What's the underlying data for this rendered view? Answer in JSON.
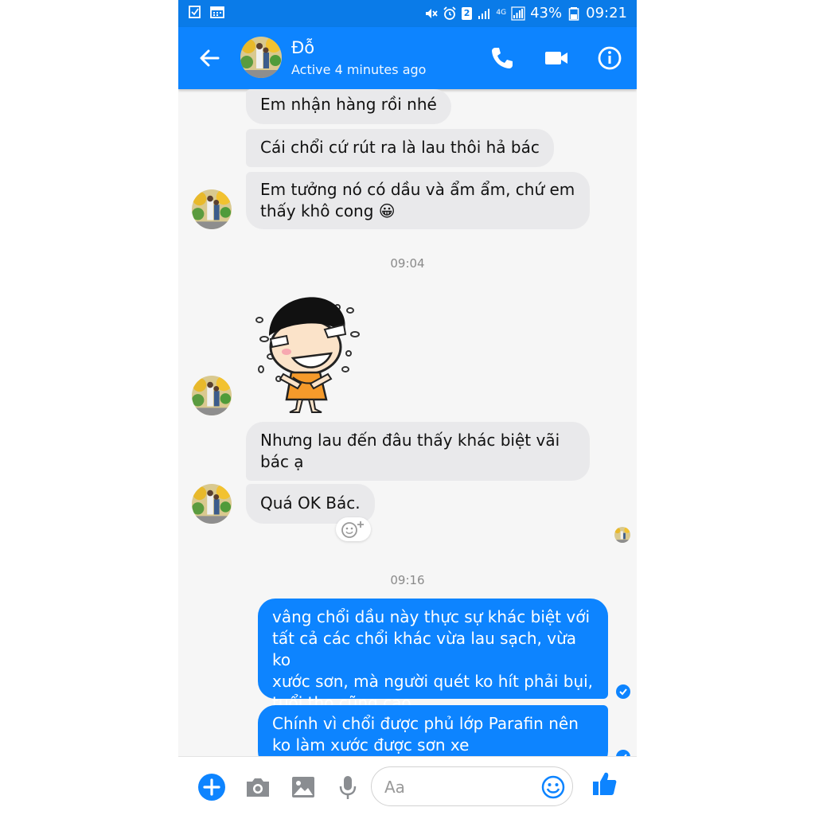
{
  "statusbar": {
    "sim_label": "2",
    "network_label": "4G",
    "battery": "43%",
    "time": "09:21"
  },
  "header": {
    "contact_name": "Đỗ",
    "contact_status": "Active 4 minutes ago"
  },
  "messages": {
    "m1": "Em nhận hàng rồi nhé",
    "m2": "Cái chổi cứ rút ra là lau thôi hả bác",
    "m3_line1": "Em tưởng nó có dầu và ẩm ẩm, chứ em",
    "m3_line2": "thấy khô cong 😀",
    "ts1": "09:04",
    "m4_line1": "Nhưng lau đến đâu thấy khác biệt vãi",
    "m4_line2": "bác ạ",
    "m5": "Quá OK Bác.",
    "ts2": "09:16",
    "m6_line1": "vâng chổi dầu này thực sự khác biệt với",
    "m6_line2": "tất cả các chổi khác vừa lau sạch, vừa ko",
    "m6_line3": "xước sơn, mà người quét ko hít phải bụi,",
    "m6_line4": "tuổi thọ cũng cao",
    "m7_line1": "Chính vì chổi được phủ lớp Parafin nên",
    "m7_line2": "ko làm xước được sơn xe"
  },
  "composer": {
    "placeholder": "Aa"
  },
  "colors": {
    "brand_blue": "#0d84ff",
    "status_blue": "#0a7be8",
    "incoming_bubble": "#e9e9eb"
  }
}
